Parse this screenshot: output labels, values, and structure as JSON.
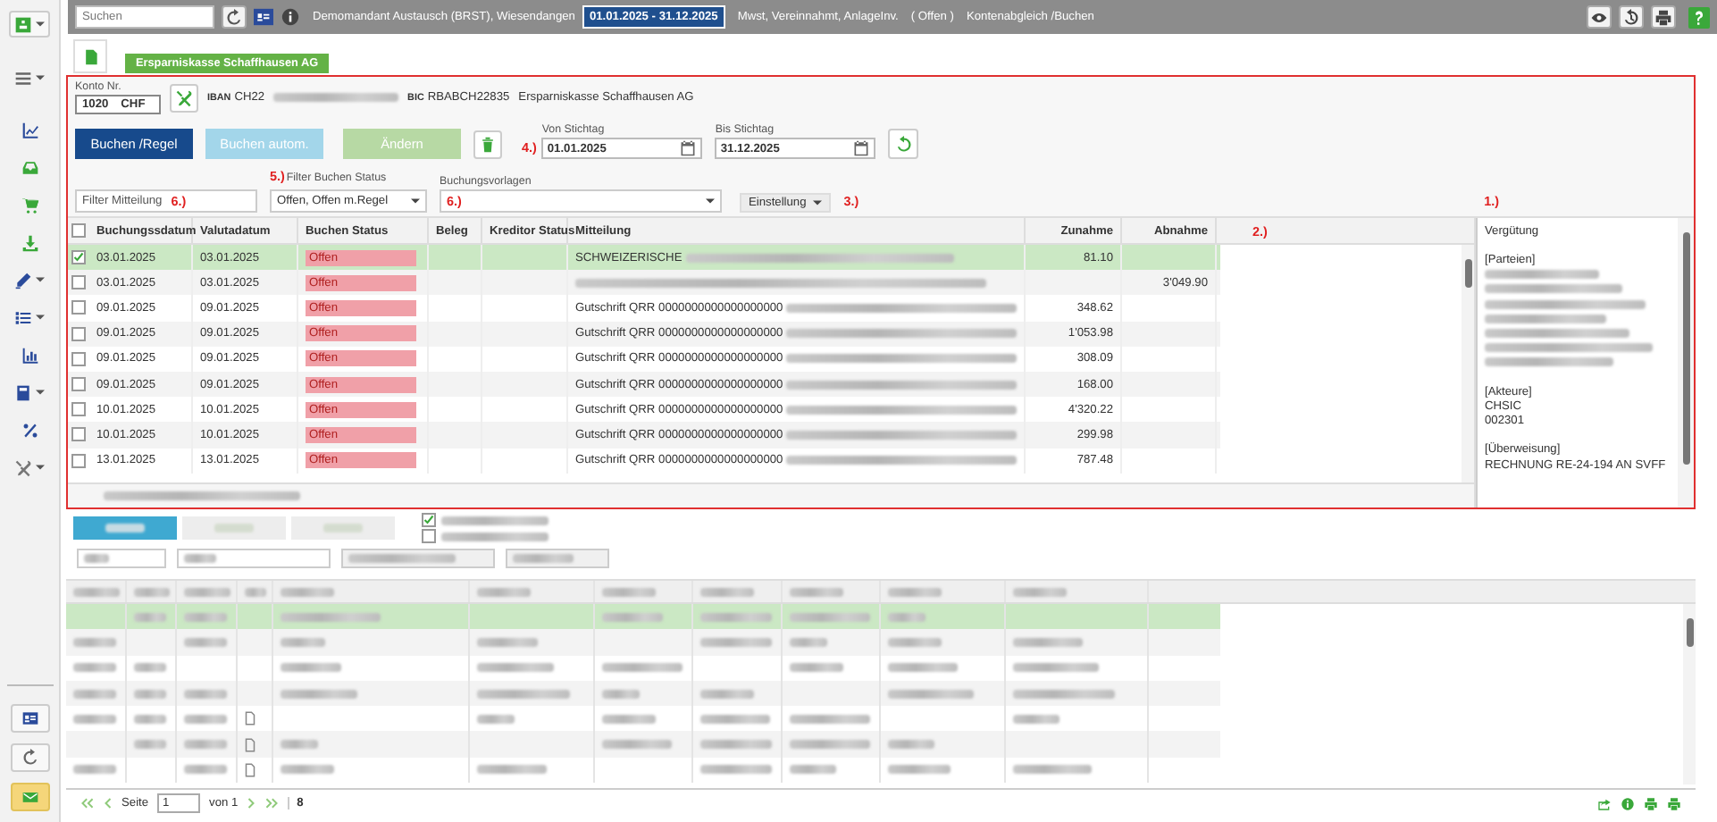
{
  "topbar": {
    "search_placeholder": "Suchen",
    "client": "Demomandant Austausch (BRST), Wiesendangen",
    "period": "01.01.2025 - 31.12.2025",
    "settings": "Mwst, Vereinnahmt, AnlageInv.",
    "status": "( Offen )",
    "view": "Kontenabgleich /Buchen"
  },
  "sidebar": {
    "items": [
      {
        "kind": "app",
        "caret": true
      },
      {
        "kind": "menu",
        "caret": true
      },
      {
        "kind": "chart",
        "caret": false
      },
      {
        "kind": "tray",
        "caret": false
      },
      {
        "kind": "cart",
        "caret": false
      },
      {
        "kind": "download",
        "caret": false
      },
      {
        "kind": "pen",
        "caret": true
      },
      {
        "kind": "list",
        "caret": true
      },
      {
        "kind": "bars",
        "caret": false
      },
      {
        "kind": "book",
        "caret": true
      },
      {
        "kind": "percent",
        "caret": false
      },
      {
        "kind": "tools",
        "caret": true
      }
    ],
    "bottom": [
      {
        "kind": "contact"
      },
      {
        "kind": "refresh"
      },
      {
        "kind": "mail"
      }
    ]
  },
  "tabs": [
    {
      "kind": "icon",
      "selected": false
    },
    {
      "kind": "label",
      "label": "Ersparniskasse Schaffhausen AG",
      "selected": true
    }
  ],
  "account": {
    "label": "Konto Nr.",
    "number": "1020",
    "currency": "CHF",
    "iban_label": "IBAN",
    "iban": "CH22",
    "bic_label": "BIC",
    "bic": "RBABCH22835",
    "bank": "Ersparniskasse Schaffhausen AG"
  },
  "actions": [
    {
      "label": "Buchen /Regel",
      "kind": "primary"
    },
    {
      "label": "Buchen autom.",
      "kind": "secondary"
    },
    {
      "label": "Ändern",
      "kind": "success"
    }
  ],
  "dates": [
    {
      "label": "Von Stichtag",
      "value": "01.01.2025",
      "marker": "4.)"
    },
    {
      "label": "Bis Stichtag",
      "value": "31.12.2025"
    }
  ],
  "filters": {
    "message": {
      "placeholder": "Filter Mitteilung",
      "marker": "6.)"
    },
    "status": {
      "label": "Filter Buchen Status",
      "value": "Offen, Offen m.Regel",
      "marker": "5.)"
    },
    "templates": {
      "label": "Buchungsvorlagen",
      "marker": "6.)"
    },
    "settings": {
      "label": "Einstellung",
      "marker": "3.)"
    }
  },
  "table": {
    "marker": "2.)",
    "all_checked": false,
    "columns": [
      "Buchungssdatum",
      "Valutadatum",
      "Buchen Status",
      "Beleg",
      "Kreditor Status",
      "Mitteilung",
      "Zunahme",
      "Abnahme"
    ],
    "rows": [
      {
        "checked": true,
        "selected": true,
        "date": "03.01.2025",
        "valuta": "03.01.2025",
        "status": "Offen",
        "message": "SCHWEIZERISCHE",
        "redacted": true,
        "increase": "81.10"
      },
      {
        "checked": false,
        "selected": false,
        "date": "03.01.2025",
        "valuta": "03.01.2025",
        "status": "Offen",
        "redacted": true,
        "decrease": "3'049.90"
      },
      {
        "checked": false,
        "selected": false,
        "date": "09.01.2025",
        "valuta": "09.01.2025",
        "status": "Offen",
        "message": "Gutschrift QRR 0000000000000000000",
        "redacted": true,
        "increase": "348.62"
      },
      {
        "checked": false,
        "selected": false,
        "date": "09.01.2025",
        "valuta": "09.01.2025",
        "status": "Offen",
        "message": "Gutschrift QRR 0000000000000000000",
        "redacted": true,
        "increase": "1'053.98"
      },
      {
        "checked": false,
        "selected": false,
        "date": "09.01.2025",
        "valuta": "09.01.2025",
        "status": "Offen",
        "message": "Gutschrift QRR 0000000000000000000",
        "redacted": true,
        "increase": "308.09"
      },
      {
        "checked": false,
        "selected": false,
        "date": "09.01.2025",
        "valuta": "09.01.2025",
        "status": "Offen",
        "message": "Gutschrift QRR 0000000000000000000",
        "redacted": true,
        "increase": "168.00"
      },
      {
        "checked": false,
        "selected": false,
        "date": "10.01.2025",
        "valuta": "10.01.2025",
        "status": "Offen",
        "message": "Gutschrift QRR 0000000000000000000",
        "redacted": true,
        "increase": "4'320.22"
      },
      {
        "checked": false,
        "selected": false,
        "date": "10.01.2025",
        "valuta": "10.01.2025",
        "status": "Offen",
        "message": "Gutschrift QRR 0000000000000000000",
        "redacted": true,
        "increase": "299.98"
      },
      {
        "checked": false,
        "selected": false,
        "date": "13.01.2025",
        "valuta": "13.01.2025",
        "status": "Offen",
        "message": "Gutschrift QRR 0000000000000000000",
        "redacted": true,
        "increase": "787.48"
      }
    ]
  },
  "details": {
    "marker": "1.)",
    "lines": [
      {
        "kind": "text",
        "text": "Vergütung"
      },
      {
        "kind": "blank"
      },
      {
        "kind": "text",
        "text": "[Parteien]"
      },
      {
        "kind": "redacted"
      },
      {
        "kind": "redacted"
      },
      {
        "kind": "redacted"
      },
      {
        "kind": "redacted"
      },
      {
        "kind": "redacted"
      },
      {
        "kind": "redacted"
      },
      {
        "kind": "redacted"
      },
      {
        "kind": "blank"
      },
      {
        "kind": "text",
        "text": "[Akteure]"
      },
      {
        "kind": "text",
        "text": "CHSIC"
      },
      {
        "kind": "text",
        "text": "002301"
      },
      {
        "kind": "blank"
      },
      {
        "kind": "text",
        "text": "[Überweisung]"
      },
      {
        "kind": "text",
        "text": "RECHNUNG RE-24-194 AN SVFF"
      }
    ]
  },
  "lower": {
    "buttons": [
      {
        "kind": "primary"
      },
      {
        "kind": "plain"
      },
      {
        "kind": "plain"
      }
    ],
    "options": [
      {
        "checked": true
      },
      {
        "checked": false
      }
    ],
    "rows": [
      {
        "selected": true,
        "attachment": false
      },
      {
        "selected": false,
        "attachment": false
      },
      {
        "selected": false,
        "attachment": false
      },
      {
        "selected": false,
        "attachment": false
      },
      {
        "selected": false,
        "attachment": true
      },
      {
        "selected": false,
        "attachment": true
      },
      {
        "selected": false,
        "attachment": true
      }
    ]
  },
  "pager": {
    "label": "Seite",
    "page": "1",
    "of": "von 1",
    "count": "8"
  }
}
